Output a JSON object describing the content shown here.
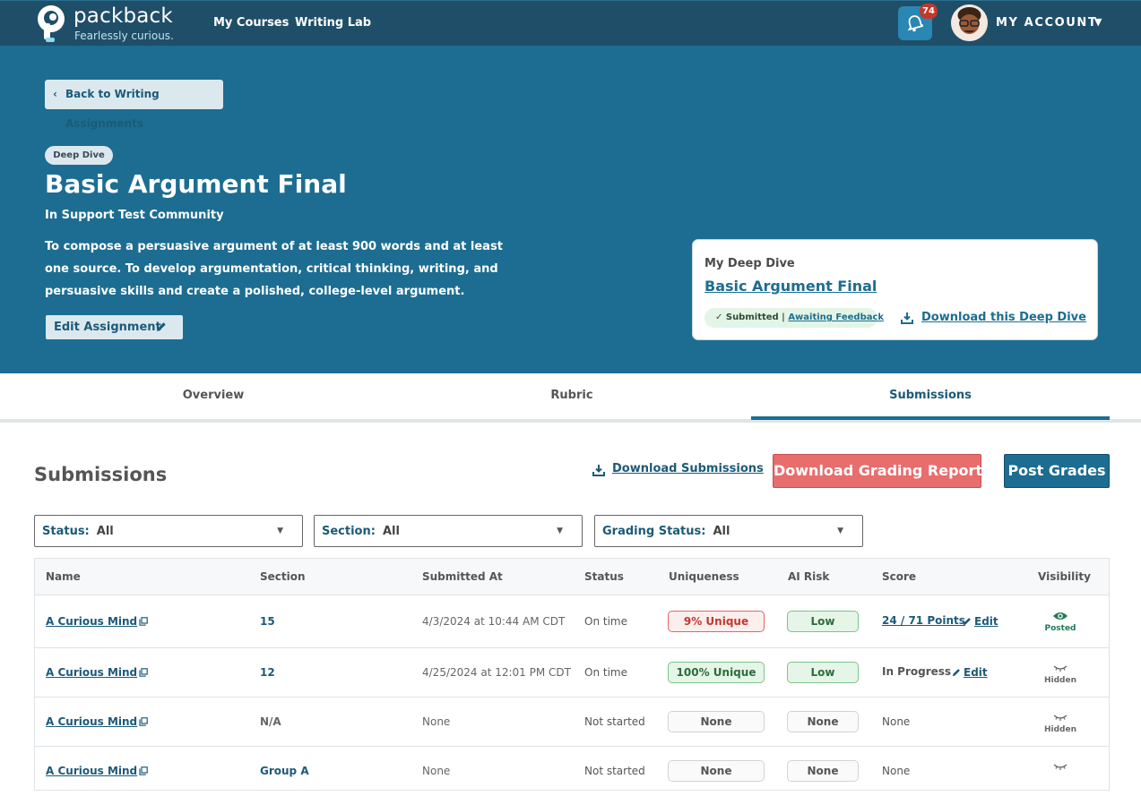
{
  "brand": {
    "name": "packback",
    "tagline": "Fearlessly curious."
  },
  "nav": {
    "links": [
      "My Courses",
      "Writing Lab"
    ],
    "notification_count": "74",
    "account_label": "MY ACCOUNT"
  },
  "hero": {
    "back_label": "Back to Writing Assignments",
    "type_pill": "Deep Dive",
    "title": "Basic Argument Final",
    "community": "In Support Test Community",
    "description": "To compose a persuasive argument of at least 900 words and at least one source. To develop argumentation, critical thinking, writing, and persuasive skills and create a polished, college-level argument.",
    "edit_label": "Edit Assignment"
  },
  "deep_dive_card": {
    "label": "My Deep Dive",
    "title": "Basic Argument Final",
    "status_prefix": "✓ Submitted |",
    "status_link": "Awaiting Feedback",
    "download_label": "Download this Deep Dive"
  },
  "tabs": [
    "Overview",
    "Rubric",
    "Submissions"
  ],
  "active_tab": "Submissions",
  "submissions": {
    "title": "Submissions",
    "download_label": "Download Submissions",
    "report_label": "Download Grading Report",
    "post_label": "Post Grades",
    "filters": [
      {
        "label": "Status:",
        "value": "All"
      },
      {
        "label": "Section:",
        "value": "All"
      },
      {
        "label": "Grading Status:",
        "value": "All"
      }
    ],
    "columns": [
      "Name",
      "Section",
      "Submitted At",
      "Status",
      "Uniqueness",
      "AI Risk",
      "Score",
      "Visibility"
    ],
    "rows": [
      {
        "name": "A Curious Mind",
        "section": "15",
        "submitted_at": "4/3/2024 at 10:44 AM CDT",
        "status": "On time",
        "uniqueness": "9% Unique",
        "ai_risk": "Low",
        "score": "24 / 71 Points",
        "edit": "Edit",
        "visibility": "Posted"
      },
      {
        "name": "A Curious Mind",
        "section": "12",
        "submitted_at": "4/25/2024 at 12:01 PM CDT",
        "status": "On time",
        "uniqueness": "100% Unique",
        "ai_risk": "Low",
        "score": "In Progress",
        "edit": "Edit",
        "visibility": "Hidden"
      },
      {
        "name": "A Curious Mind",
        "section": "N/A",
        "submitted_at": "None",
        "status": "Not started",
        "uniqueness": "None",
        "ai_risk": "None",
        "score": "None",
        "visibility": "Hidden"
      },
      {
        "name": "A Curious Mind",
        "section": "Group A",
        "submitted_at": "None",
        "status": "Not started",
        "uniqueness": "None",
        "ai_risk": "None",
        "score": "None"
      }
    ]
  },
  "colors": {
    "nav_bg": "#1f4e68",
    "hero_bg": "#1c6d91",
    "accent_red": "#e86d6d",
    "accent_blue": "#1c6d91"
  }
}
